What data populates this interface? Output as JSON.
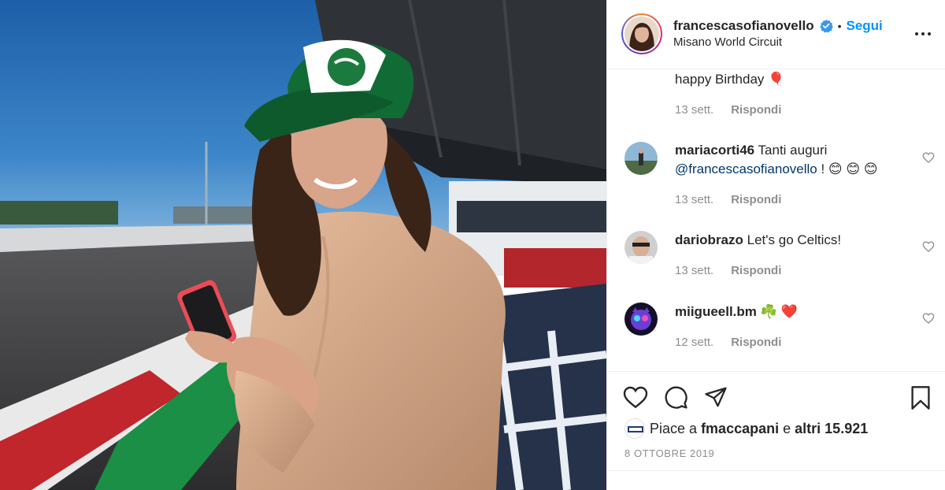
{
  "post": {
    "username": "francescasofianovello",
    "follow_label": "Segui",
    "dot": "•",
    "location": "Misano World Circuit"
  },
  "comments": [
    {
      "username": "",
      "text": "happy Birthday 🎈",
      "time": "13 sett.",
      "reply": "Rispondi"
    },
    {
      "username": "mariacorti46",
      "text": "Tanti auguri",
      "mention": "@francescasofianovello",
      "emoji": "! 😊 😊 😊",
      "time": "13 sett.",
      "reply": "Rispondi"
    },
    {
      "username": "dariobrazo",
      "text": "Let's go Celtics!",
      "time": "13 sett.",
      "reply": "Rispondi"
    },
    {
      "username": "miigueell.bm",
      "text": "☘️ ❤️",
      "time": "12 sett.",
      "reply": "Rispondi"
    }
  ],
  "likes": {
    "prefix": "Piace a",
    "user": "fmaccapani",
    "conj": "e",
    "others": "altri 15.921"
  },
  "date": "8 OTTOBRE 2019",
  "icons": [
    "verified-badge-icon",
    "more-icon",
    "heart-icon",
    "comment-icon",
    "share-icon",
    "bookmark-icon"
  ],
  "colors": {
    "link": "#0095f6",
    "secondary": "#8e8e8e",
    "text": "#262626",
    "mention": "#00376b"
  }
}
